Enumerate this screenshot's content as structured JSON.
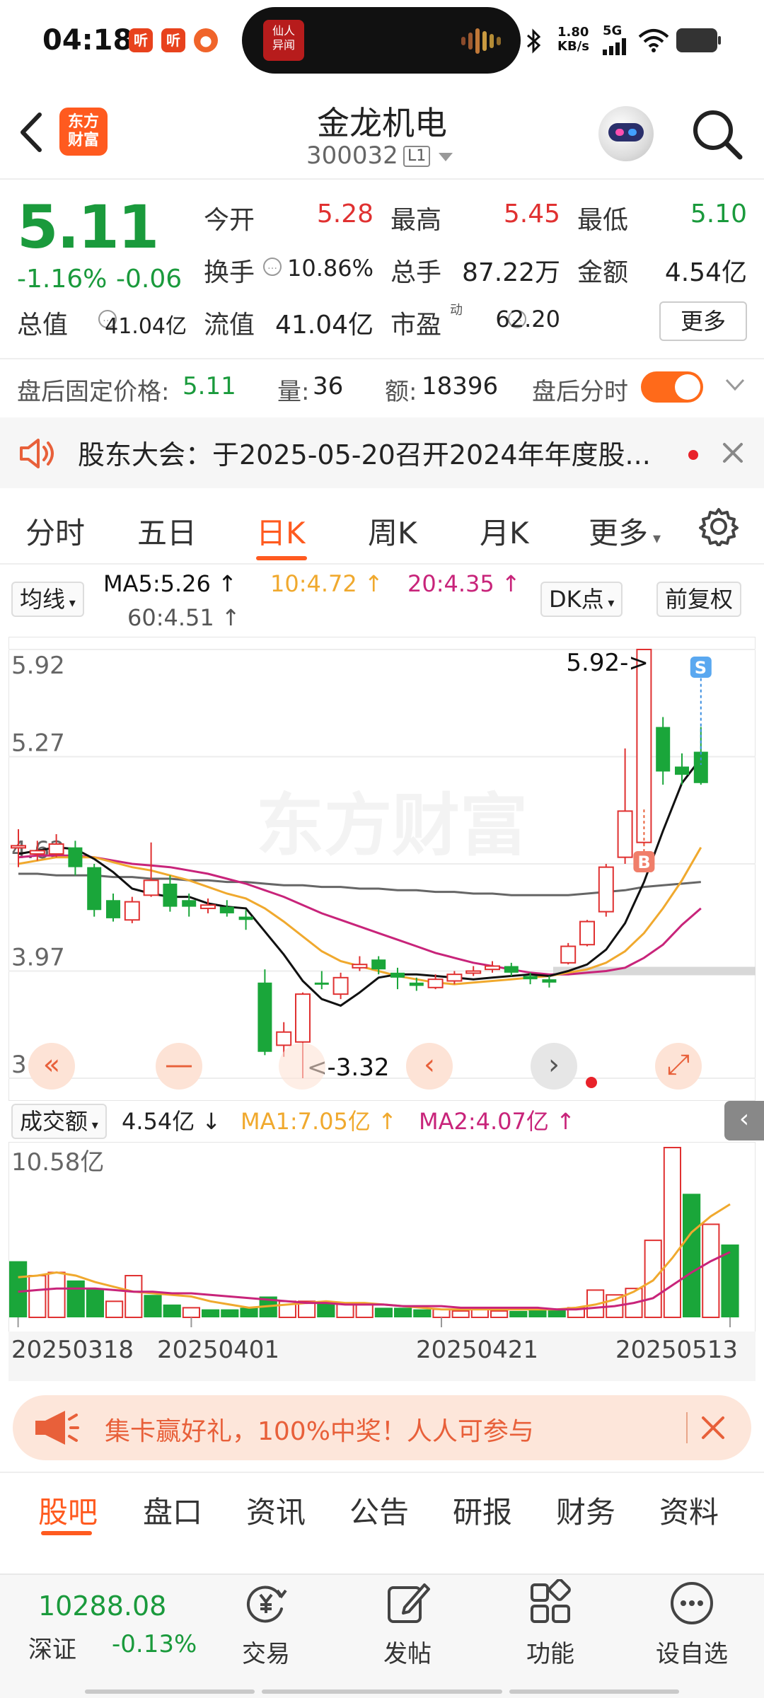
{
  "status_bar": {
    "time": "04:18",
    "app_badges": [
      "听",
      "听"
    ],
    "island_thumb_text": "仙人\n异闻",
    "net_speed": "1.80",
    "net_unit": "KB/s",
    "signal": "5G"
  },
  "header": {
    "title": "金龙机电",
    "code": "300032",
    "code_tag": "L1",
    "logo_text": "东方\n财富"
  },
  "quote": {
    "price": "5.11",
    "change_pct": "-1.16%",
    "change_abs": "-0.06",
    "open_label": "今开",
    "open_value": "5.28",
    "high_label": "最高",
    "high_value": "5.45",
    "low_label": "最低",
    "low_value": "5.10",
    "turnover_label": "换手",
    "turnover_value": "10.86%",
    "volume_label": "总手",
    "volume_value": "87.22万",
    "amount_label": "金额",
    "amount_value": "4.54亿",
    "mcap_label": "总值",
    "mcap_value": "41.04亿",
    "float_label": "流值",
    "float_value": "41.04亿",
    "pe_label": "市盈",
    "pe_sup": "动",
    "pe_value": "62.20",
    "more_label": "更多"
  },
  "after_hours": {
    "price_label": "盘后固定价格:",
    "price_value": "5.11",
    "vol_label": "量:",
    "vol_value": "36",
    "amt_label": "额:",
    "amt_value": "18396",
    "toggle_label": "盘后分时"
  },
  "notice": {
    "text": "股东大会：于2025-05-20召开2024年年度股..."
  },
  "period_tabs": {
    "items": [
      "分时",
      "五日",
      "日K",
      "周K",
      "月K",
      "更多"
    ],
    "active": "日K"
  },
  "ma_legend": {
    "selector": "均线",
    "ma5": "MA5:5.26 ↑",
    "ma10": "10:4.72 ↑",
    "ma20": "20:4.35 ↑",
    "ma60": "60:4.51 ↑",
    "dk": "DK点",
    "adjust": "前复权",
    "colors": {
      "ma5": "#111111",
      "ma10": "#f0a92e",
      "ma20": "#c8247a",
      "ma60": "#666666"
    }
  },
  "chart_data": [
    {
      "type": "candlestick",
      "title": "日K",
      "y_ticks": [
        "5.92",
        "5.27",
        "4.62",
        "3.97",
        "3.32"
      ],
      "ylim": [
        3.32,
        5.92
      ],
      "annotations": {
        "high": "5.92->",
        "low": "<-3.32"
      },
      "markers": {
        "buy": "B",
        "sell": "S"
      },
      "candles": [
        {
          "o": 4.73,
          "c": 4.73,
          "h": 4.83,
          "l": 4.6
        },
        {
          "o": 4.68,
          "c": 4.7,
          "h": 4.76,
          "l": 4.64
        },
        {
          "o": 4.68,
          "c": 4.74,
          "h": 4.8,
          "l": 4.66
        },
        {
          "o": 4.72,
          "c": 4.6,
          "h": 4.76,
          "l": 4.55
        },
        {
          "o": 4.6,
          "c": 4.34,
          "h": 4.62,
          "l": 4.3
        },
        {
          "o": 4.4,
          "c": 4.29,
          "h": 4.44,
          "l": 4.27
        },
        {
          "o": 4.28,
          "c": 4.39,
          "h": 4.42,
          "l": 4.26
        },
        {
          "o": 4.43,
          "c": 4.52,
          "h": 4.75,
          "l": 4.42
        },
        {
          "o": 4.5,
          "c": 4.36,
          "h": 4.55,
          "l": 4.33
        },
        {
          "o": 4.4,
          "c": 4.36,
          "h": 4.44,
          "l": 4.3
        },
        {
          "o": 4.35,
          "c": 4.37,
          "h": 4.41,
          "l": 4.32
        },
        {
          "o": 4.36,
          "c": 4.32,
          "h": 4.4,
          "l": 4.3
        },
        {
          "o": 4.3,
          "c": 4.28,
          "h": 4.34,
          "l": 4.22
        },
        {
          "o": 3.9,
          "c": 3.48,
          "h": 3.98,
          "l": 3.46
        },
        {
          "o": 3.52,
          "c": 3.6,
          "h": 3.66,
          "l": 3.45
        },
        {
          "o": 3.54,
          "c": 3.83,
          "h": 3.84,
          "l": 3.32
        },
        {
          "o": 3.9,
          "c": 3.89,
          "h": 3.97,
          "l": 3.86
        },
        {
          "o": 3.83,
          "c": 3.93,
          "h": 3.96,
          "l": 3.8
        },
        {
          "o": 3.99,
          "c": 4.01,
          "h": 4.06,
          "l": 3.97
        },
        {
          "o": 4.04,
          "c": 3.98,
          "h": 4.06,
          "l": 3.95
        },
        {
          "o": 3.96,
          "c": 3.93,
          "h": 3.99,
          "l": 3.86
        },
        {
          "o": 3.9,
          "c": 3.88,
          "h": 3.93,
          "l": 3.85
        },
        {
          "o": 3.87,
          "c": 3.92,
          "h": 3.95,
          "l": 3.86
        },
        {
          "o": 3.91,
          "c": 3.95,
          "h": 3.97,
          "l": 3.89
        },
        {
          "o": 3.96,
          "c": 3.97,
          "h": 4.0,
          "l": 3.94
        },
        {
          "o": 3.98,
          "c": 4.0,
          "h": 4.03,
          "l": 3.96
        },
        {
          "o": 4.0,
          "c": 3.96,
          "h": 4.02,
          "l": 3.94
        },
        {
          "o": 3.94,
          "c": 3.92,
          "h": 3.96,
          "l": 3.89
        },
        {
          "o": 3.92,
          "c": 3.9,
          "h": 3.94,
          "l": 3.87
        },
        {
          "o": 4.02,
          "c": 4.12,
          "h": 4.14,
          "l": 4.01
        },
        {
          "o": 4.13,
          "c": 4.27,
          "h": 4.28,
          "l": 4.12
        },
        {
          "o": 4.33,
          "c": 4.6,
          "h": 4.62,
          "l": 4.3
        },
        {
          "o": 4.66,
          "c": 4.94,
          "h": 5.32,
          "l": 4.62
        },
        {
          "o": 4.75,
          "c": 5.92,
          "h": 5.92,
          "l": 4.73
        },
        {
          "o": 5.45,
          "c": 5.18,
          "h": 5.51,
          "l": 5.1
        },
        {
          "o": 5.21,
          "c": 5.16,
          "h": 5.29,
          "l": 5.1
        },
        {
          "o": 5.3,
          "c": 5.11,
          "h": 5.45,
          "l": 5.1
        }
      ],
      "ma5": [
        4.68,
        4.7,
        4.72,
        4.71,
        4.65,
        4.57,
        4.47,
        4.44,
        4.42,
        4.42,
        4.38,
        4.36,
        4.35,
        4.21,
        4.07,
        3.91,
        3.8,
        3.76,
        3.84,
        3.93,
        3.95,
        3.95,
        3.94,
        3.93,
        3.92,
        3.93,
        3.94,
        3.95,
        3.94,
        3.97,
        4.01,
        4.1,
        4.26,
        4.51,
        4.82,
        5.11,
        5.26
      ],
      "ma10": [
        4.62,
        4.64,
        4.66,
        4.66,
        4.66,
        4.63,
        4.6,
        4.58,
        4.55,
        4.52,
        4.48,
        4.44,
        4.41,
        4.35,
        4.27,
        4.18,
        4.09,
        4.03,
        4.0,
        3.97,
        3.94,
        3.92,
        3.9,
        3.89,
        3.9,
        3.91,
        3.92,
        3.93,
        3.94,
        3.96,
        3.98,
        4.02,
        4.09,
        4.2,
        4.35,
        4.52,
        4.72
      ],
      "ma20": [
        4.66,
        4.67,
        4.67,
        4.67,
        4.66,
        4.64,
        4.62,
        4.61,
        4.6,
        4.58,
        4.56,
        4.53,
        4.5,
        4.46,
        4.42,
        4.37,
        4.32,
        4.28,
        4.24,
        4.2,
        4.16,
        4.12,
        4.08,
        4.05,
        4.02,
        4.0,
        3.98,
        3.96,
        3.95,
        3.95,
        3.96,
        3.97,
        3.99,
        4.05,
        4.13,
        4.25,
        4.35
      ],
      "ma60": [
        4.56,
        4.56,
        4.55,
        4.55,
        4.55,
        4.54,
        4.54,
        4.53,
        4.53,
        4.52,
        4.52,
        4.51,
        4.51,
        4.5,
        4.49,
        4.49,
        4.48,
        4.48,
        4.47,
        4.47,
        4.46,
        4.46,
        4.45,
        4.45,
        4.44,
        4.44,
        4.43,
        4.43,
        4.43,
        4.43,
        4.44,
        4.45,
        4.46,
        4.48,
        4.49,
        4.5,
        4.51
      ]
    },
    {
      "type": "bar",
      "title": "成交额",
      "y_ticks": [
        "10.58亿"
      ],
      "ylim": [
        0,
        10.58
      ],
      "legend": {
        "value": "4.54亿 ↓",
        "ma1": "MA1:7.05亿 ↑",
        "ma2": "MA2:4.07亿 ↑"
      },
      "x_ticks": [
        "20250318",
        "20250401",
        "20250421",
        "20250513"
      ],
      "values": [
        3.5,
        2.6,
        2.8,
        2.3,
        1.8,
        1.0,
        2.6,
        1.4,
        0.8,
        0.6,
        0.5,
        0.5,
        0.6,
        1.3,
        1.0,
        1.0,
        0.9,
        0.9,
        0.8,
        0.6,
        0.6,
        0.5,
        0.5,
        0.4,
        0.5,
        0.4,
        0.4,
        0.5,
        0.5,
        0.6,
        1.7,
        1.4,
        1.8,
        4.8,
        10.58,
        7.7,
        5.8,
        4.54
      ],
      "up": [
        false,
        true,
        true,
        false,
        false,
        true,
        true,
        false,
        false,
        true,
        false,
        false,
        false,
        false,
        true,
        true,
        false,
        true,
        true,
        false,
        false,
        false,
        true,
        true,
        true,
        true,
        false,
        false,
        false,
        true,
        true,
        true,
        true,
        true,
        true,
        false,
        true,
        false
      ],
      "ma1": [
        2.5,
        2.6,
        2.8,
        2.6,
        2.2,
        1.9,
        1.6,
        1.5,
        1.4,
        1.3,
        1.0,
        0.8,
        0.6,
        0.7,
        0.8,
        0.9,
        1.0,
        0.9,
        0.9,
        0.8,
        0.7,
        0.6,
        0.5,
        0.5,
        0.5,
        0.5,
        0.5,
        0.5,
        0.5,
        0.6,
        0.8,
        1.1,
        1.6,
        2.3,
        3.7,
        5.3,
        6.3,
        7.05
      ],
      "ma2": [
        1.6,
        1.7,
        1.8,
        1.8,
        1.8,
        1.7,
        1.6,
        1.6,
        1.5,
        1.5,
        1.4,
        1.3,
        1.2,
        1.1,
        1.0,
        0.9,
        0.9,
        0.8,
        0.8,
        0.8,
        0.7,
        0.7,
        0.7,
        0.6,
        0.6,
        0.6,
        0.6,
        0.6,
        0.5,
        0.5,
        0.6,
        0.7,
        0.9,
        1.2,
        2.0,
        2.8,
        3.5,
        4.07
      ]
    }
  ],
  "chart_controls": [
    "«",
    "—",
    "",
    "‹",
    "›",
    "⤢"
  ],
  "promo": {
    "text": "集卡赢好礼，100%中奖！人人可参与"
  },
  "bottom_tabs": {
    "items": [
      "股吧",
      "盘口",
      "资讯",
      "公告",
      "研报",
      "财务",
      "资料"
    ],
    "active": "股吧"
  },
  "nav": {
    "index_value": "10288.08",
    "index_name": "深证",
    "index_change": "-0.13%",
    "items": [
      "交易",
      "发帖",
      "功能",
      "设自选"
    ]
  },
  "colors": {
    "accent": "#ff5a1f",
    "up": "#e03131",
    "down": "#1a9a3c",
    "candle_down": "#1aa63a"
  }
}
